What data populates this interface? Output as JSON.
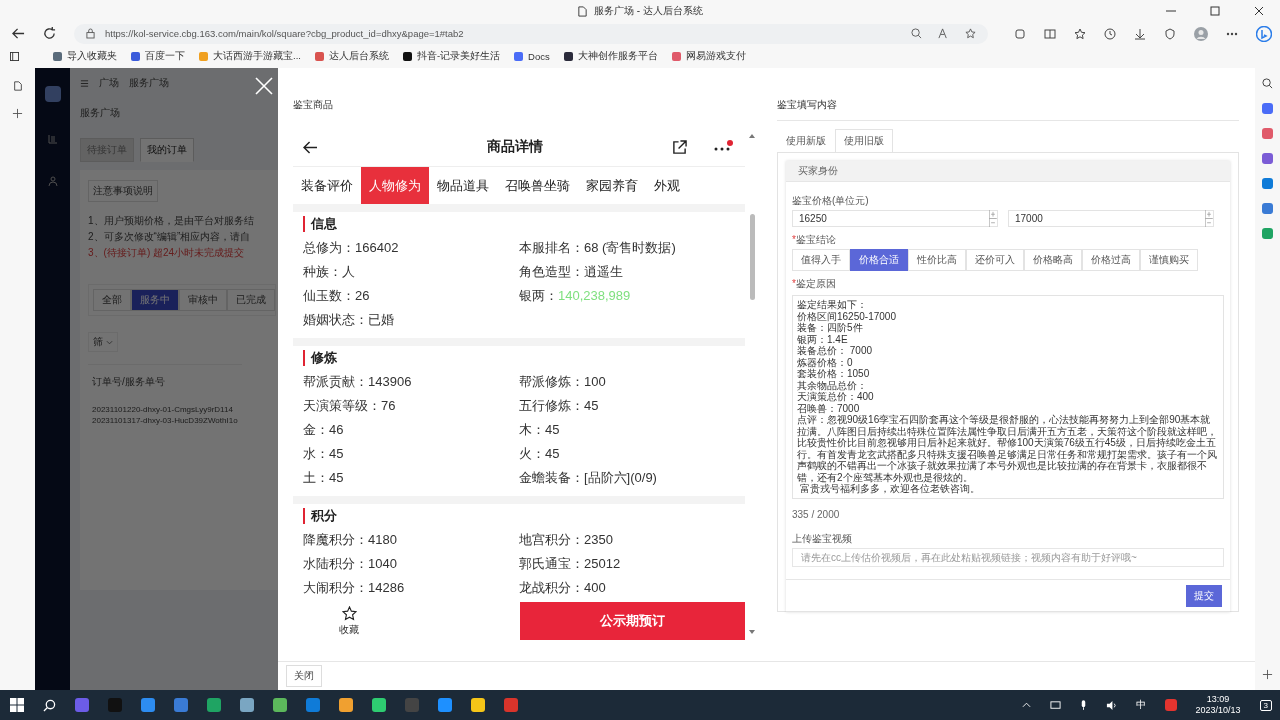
{
  "browser": {
    "tab_title": "服务广场 - 达人后台系统",
    "url": "https://kol-service.cbg.163.com/main/kol/square?cbg_product_id=dhxy&page=1#tab2",
    "bookmarks": [
      {
        "label": "导入收藏夹",
        "color": "#5a6b7b"
      },
      {
        "label": "百度一下",
        "color": "#3b5bdb"
      },
      {
        "label": "大话西游手游藏宝...",
        "color": "#f0a020"
      },
      {
        "label": "达人后台系统",
        "color": "#d9534f"
      },
      {
        "label": "抖音-记录美好生活",
        "color": "#111111"
      },
      {
        "label": "Docs",
        "color": "#4a6cf7"
      },
      {
        "label": "大神创作服务平台",
        "color": "#2b2b3b"
      },
      {
        "label": "网易游戏支付",
        "color": "#e05a6a"
      }
    ]
  },
  "dimmed_app": {
    "breadcrumb": [
      "广场",
      "服务广场"
    ],
    "title": "服务广场",
    "tabs": [
      {
        "label": "待接订单",
        "selected": false
      },
      {
        "label": "我的订单",
        "selected": true
      }
    ],
    "notice_title": "注意事项说明",
    "notices": [
      {
        "text": "1、用户预期价格，是由平台对服务结",
        "kind": "normal"
      },
      {
        "text": "2、可多次修改“编辑”相应内容，请自",
        "kind": "normal"
      },
      {
        "text": "3、(待接订单) 超24小时未完成提交",
        "kind": "warning"
      }
    ],
    "status_tabs": [
      {
        "label": "全部",
        "selected": false
      },
      {
        "label": "服务中",
        "selected": true
      },
      {
        "label": "审核中",
        "selected": false
      },
      {
        "label": "已完成",
        "selected": false
      }
    ],
    "filter": "筛",
    "table_header": "订单号/服务单号",
    "order_ids": [
      "20231101220-dhxy-01-CmgsLyy9rD114",
      "20231101317-dhxy-03-HucD39ZWothI1o"
    ]
  },
  "drawer": {
    "left_title": "鉴宝商品",
    "right_title": "鉴宝填写内容",
    "close_button": "关闭"
  },
  "product": {
    "title": "商品详情",
    "has_notice": true,
    "tabs": [
      {
        "label": "装备评价",
        "selected": false
      },
      {
        "label": "人物修为",
        "selected": true
      },
      {
        "label": "物品道具",
        "selected": false
      },
      {
        "label": "召唤兽坐骑",
        "selected": false
      },
      {
        "label": "家园养育",
        "selected": false
      },
      {
        "label": "外观",
        "selected": false
      }
    ],
    "sections": [
      {
        "title": "信息",
        "items": [
          {
            "label": "总修为：",
            "value": "166402"
          },
          {
            "label": "本服排名：",
            "value": "68 (寄售时数据)"
          },
          {
            "label": "种族：",
            "value": "人"
          },
          {
            "label": "角色造型：",
            "value": "逍遥生"
          },
          {
            "label": "仙玉数：",
            "value": "26"
          },
          {
            "label": "银两：",
            "value": "140,238,989",
            "color": "#7fe07f"
          },
          {
            "label": "婚姻状态：",
            "value": "已婚"
          }
        ]
      },
      {
        "title": "修炼",
        "items": [
          {
            "label": "帮派贡献：",
            "value": "143906"
          },
          {
            "label": "帮派修炼：",
            "value": "100"
          },
          {
            "label": "天演策等级：",
            "value": "76"
          },
          {
            "label": "五行修炼：",
            "value": "45"
          },
          {
            "label": "金：",
            "value": "46"
          },
          {
            "label": "木：",
            "value": "45"
          },
          {
            "label": "水：",
            "value": "45"
          },
          {
            "label": "火：",
            "value": "45"
          },
          {
            "label": "土：",
            "value": "45"
          },
          {
            "label": "金蟾装备：",
            "value": "[品阶六](0/9)"
          }
        ]
      },
      {
        "title": "积分",
        "items": [
          {
            "label": "降魔积分：",
            "value": "4180"
          },
          {
            "label": "地宫积分：",
            "value": "2350"
          },
          {
            "label": "水陆积分：",
            "value": "1040"
          },
          {
            "label": "郭氏通宝：",
            "value": "25012"
          },
          {
            "label": "大闹积分：",
            "value": "14286"
          },
          {
            "label": "龙战积分：",
            "value": "400"
          }
        ]
      }
    ],
    "favorite": "收藏",
    "buy_button": "公示期预订"
  },
  "form": {
    "tabs": [
      {
        "label": "使用新版",
        "selected": false
      },
      {
        "label": "使用旧版",
        "selected": true
      }
    ],
    "panel_title": "买家身份",
    "price_label": "鉴宝价格(单位元)",
    "price_min": "16250",
    "price_max": "17000",
    "conclusion_label": {
      "mark": "*",
      "text": "鉴宝结论"
    },
    "conclusions": [
      {
        "label": "值得入手",
        "selected": false
      },
      {
        "label": "价格合适",
        "selected": true
      },
      {
        "label": "性价比高",
        "selected": false
      },
      {
        "label": "还价可入",
        "selected": false
      },
      {
        "label": "价格略高",
        "selected": false
      },
      {
        "label": "价格过高",
        "selected": false
      },
      {
        "label": "谨慎购买",
        "selected": false
      }
    ],
    "reason_label": {
      "mark": "*",
      "text": "鉴定原因"
    },
    "reason_lines": [
      "鉴定结果如下：",
      "价格区间16250-17000",
      "装备：四阶5件",
      "银两：1.4E",
      "装备总价： 7000",
      "炼器价格：0",
      "套装价格：1050",
      "其余物品总价：",
      "天演策总价：400",
      "召唤兽：7000",
      "点评：忽视90级16孪宝石四阶套再这个等级是很舒服的，心法技能再努努力上到全部90基本就拉满。八阵图日后持续出特殊位置阵法属性争取日后满开五方五老，天策符这个阶段就这样吧，比较贵性价比目前忽视够用日后补起来就好。帮修100天演策76级五行45级，日后持续吃金土五行。有首发青龙玄武搭配多只特殊支援召唤兽足够满足日常任务和常规打架需求。孩子有一个风声鹤唳的不错再出一个冰孩子就效果拉满了本号外观也是比较拉满的存在背景卡，衣服都很不错，还有2个座驾基本外观也是很炫的。",
      " 富贵戎号福利多多，欢迎各位老铁咨询。"
    ],
    "char_count": "335 / 2000",
    "video_label": "上传鉴宝视频",
    "video_placeholder": "请先在cc上传估价视频后，再在此处粘贴视频链接；视频内容有助于好评哦~",
    "submit": "提交"
  },
  "taskbar": {
    "ime": "中",
    "time": "13:09",
    "date": "2023/10/13",
    "notifications": "3"
  }
}
